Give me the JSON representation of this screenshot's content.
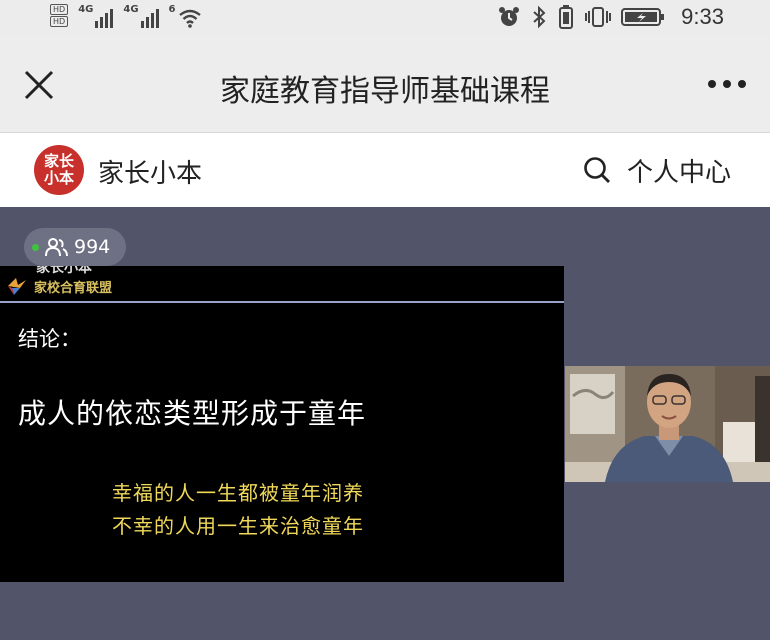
{
  "status_bar": {
    "hd_badges": [
      "HD",
      "HD"
    ],
    "network_1": "4G",
    "network_2": "4G",
    "wifi_label": "6",
    "time": "9:33",
    "icons": [
      "alarm-icon",
      "bluetooth-icon",
      "battery-saver-icon",
      "vibrate-icon",
      "battery-icon"
    ]
  },
  "nav": {
    "title": "家庭教育指导师基础课程",
    "close_icon": "close-icon",
    "more_icon": "more-icon"
  },
  "brand": {
    "logo_line1": "家长",
    "logo_line2": "小本",
    "name": "家长小本",
    "search_icon": "search-icon",
    "personal_center": "个人中心",
    "logo_color": "#c7302b"
  },
  "live": {
    "viewer_count": "994",
    "live_dot_color": "#3ec33e",
    "slide": {
      "brand_top": "家长小本",
      "brand_union": "家校合育联盟",
      "conclusion": "结论：",
      "main_text": "成人的依恋类型形成于童年",
      "line1": "幸福的人一生都被童年润养",
      "line2": "不幸的人用一生来治愈童年",
      "highlight_color": "#f0d85a"
    },
    "camera_feed": "presenter-video"
  }
}
